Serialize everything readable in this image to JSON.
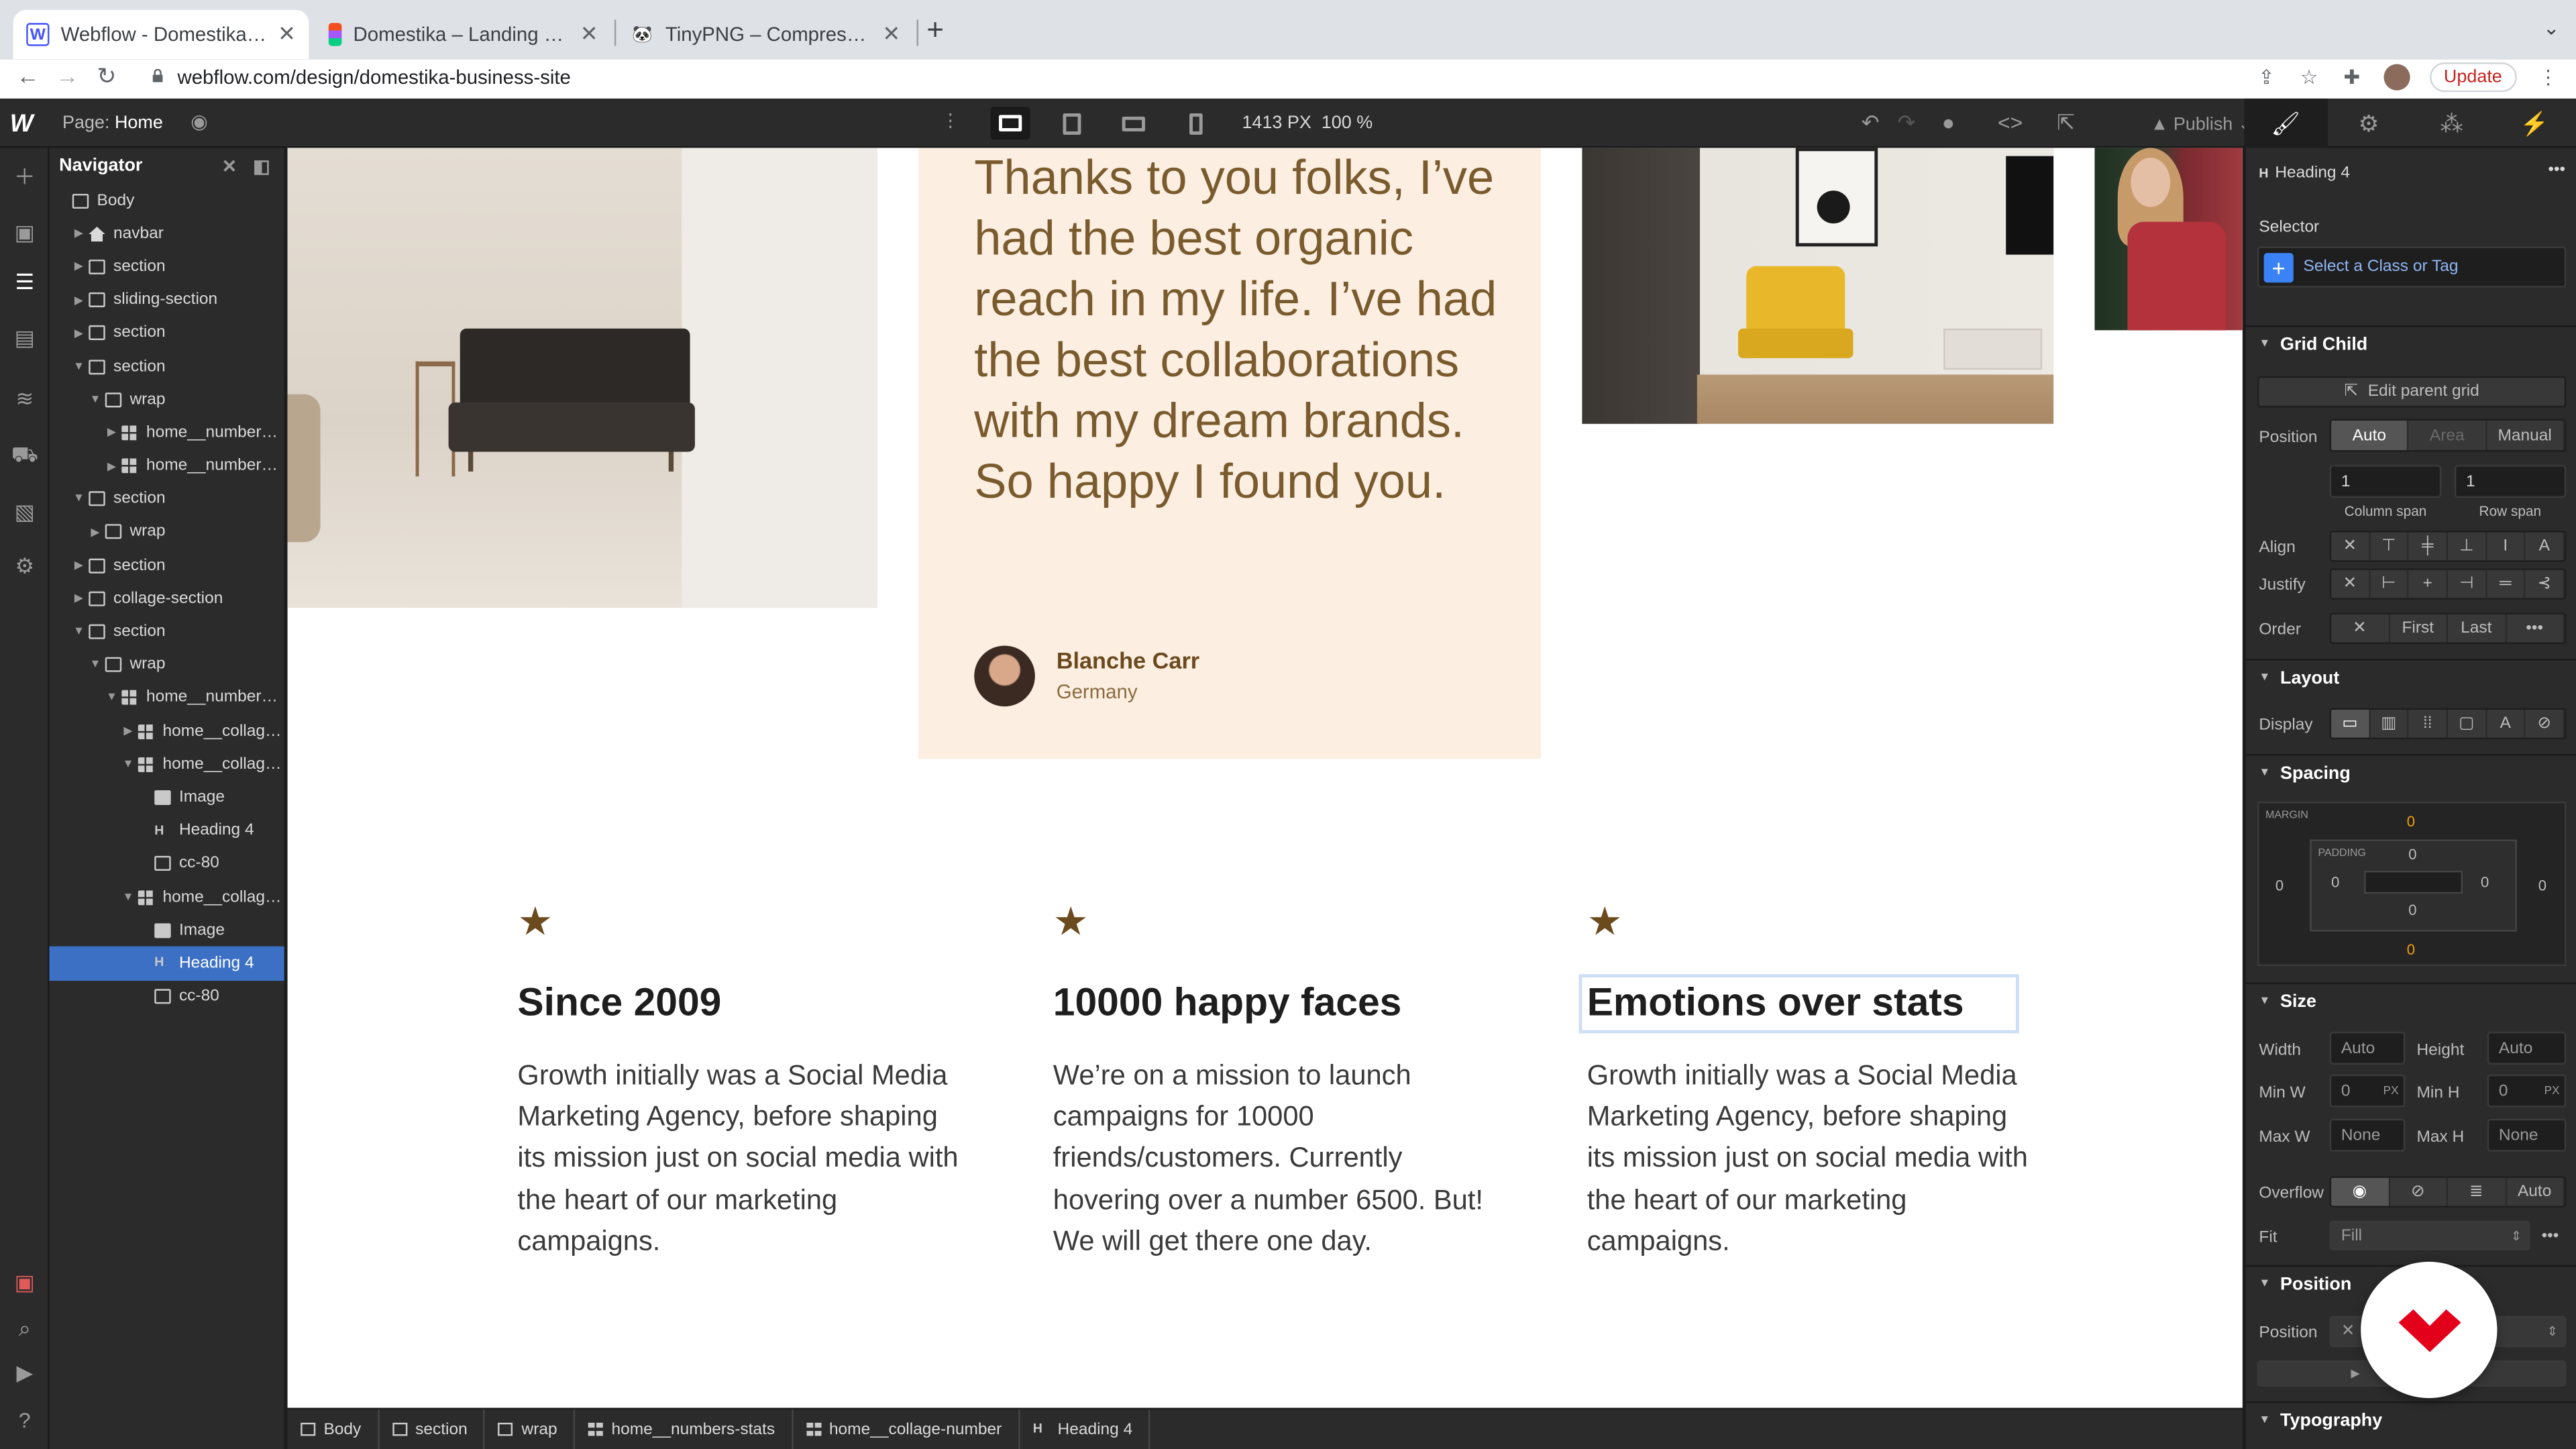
{
  "browser": {
    "tabs": [
      {
        "title": "Webflow - Domestika - Landing Page",
        "active": true
      },
      {
        "title": "Domestika – Landing Page – Figma",
        "active": false
      },
      {
        "title": "TinyPNG – Compress WebP, PNG and JPEG",
        "active": false
      }
    ],
    "url": "webflow.com/design/domestika-business-site",
    "update_label": "Update"
  },
  "designer": {
    "page_label": "Page:",
    "page_name": "Home",
    "canvas_width": "1413 PX",
    "zoom": "100 %",
    "publish_label": "Publish"
  },
  "navigator": {
    "title": "Navigator",
    "items": [
      {
        "label": "Body",
        "depth": 0,
        "caret": "",
        "icon": "box"
      },
      {
        "label": "navbar",
        "depth": 1,
        "caret": "▶",
        "icon": "home"
      },
      {
        "label": "section",
        "depth": 1,
        "caret": "▶",
        "icon": "box"
      },
      {
        "label": "sliding-section",
        "depth": 1,
        "caret": "▶",
        "icon": "box"
      },
      {
        "label": "section",
        "depth": 1,
        "caret": "▶",
        "icon": "box"
      },
      {
        "label": "section",
        "depth": 1,
        "caret": "▼",
        "icon": "box"
      },
      {
        "label": "wrap",
        "depth": 2,
        "caret": "▼",
        "icon": "box"
      },
      {
        "label": "home__numbers-heading",
        "depth": 3,
        "caret": "▶",
        "icon": "grid"
      },
      {
        "label": "home__numbers-stats",
        "depth": 3,
        "caret": "▶",
        "icon": "grid"
      },
      {
        "label": "section",
        "depth": 1,
        "caret": "▼",
        "icon": "box"
      },
      {
        "label": "wrap",
        "depth": 2,
        "caret": "▶",
        "icon": "box"
      },
      {
        "label": "section",
        "depth": 1,
        "caret": "▶",
        "icon": "box"
      },
      {
        "label": "collage-section",
        "depth": 1,
        "caret": "▶",
        "icon": "box"
      },
      {
        "label": "section",
        "depth": 1,
        "caret": "▼",
        "icon": "box"
      },
      {
        "label": "wrap",
        "depth": 2,
        "caret": "▼",
        "icon": "box"
      },
      {
        "label": "home__numbers-stats",
        "depth": 3,
        "caret": "▼",
        "icon": "grid"
      },
      {
        "label": "home__collage-number",
        "depth": 4,
        "caret": "▶",
        "icon": "grid"
      },
      {
        "label": "home__collage-number",
        "depth": 4,
        "caret": "▼",
        "icon": "grid"
      },
      {
        "label": "Image",
        "depth": 5,
        "caret": "",
        "icon": "img"
      },
      {
        "label": "Heading 4",
        "depth": 5,
        "caret": "",
        "icon": "heading"
      },
      {
        "label": "cc-80",
        "depth": 5,
        "caret": "",
        "icon": "text"
      },
      {
        "label": "home__collage-number",
        "depth": 4,
        "caret": "▼",
        "icon": "grid"
      },
      {
        "label": "Image",
        "depth": 5,
        "caret": "",
        "icon": "img"
      },
      {
        "label": "Heading 4",
        "depth": 5,
        "caret": "",
        "icon": "heading",
        "selected": true
      },
      {
        "label": "cc-80",
        "depth": 5,
        "caret": "",
        "icon": "text"
      }
    ]
  },
  "canvas": {
    "quote": "Thanks to you folks, I’ve had the best organic reach in my life. I’ve had the best collaborations with my dream brands. So happy I found you.",
    "author_name": "Blanche Carr",
    "author_location": "Germany",
    "features": [
      {
        "title": "Since 2009",
        "body": "Growth initially was a Social Media Marketing Agency, before shaping its mission just on social media with the heart of our marketing campaigns.",
        "selected": false
      },
      {
        "title": "10000 happy faces",
        "body": "We’re on a mission to launch campaigns for 10000 friends/customers. Currently hovering over a number 6500. But! We will get there one day.",
        "selected": false
      },
      {
        "title": "Emotions over stats",
        "body": "Growth initially was a Social Media Marketing Agency, before shaping its mission just on social media with the heart of our marketing campaigns.",
        "selected": true
      }
    ]
  },
  "breadcrumbs": [
    {
      "label": "Body",
      "icon": "box"
    },
    {
      "label": "section",
      "icon": "box"
    },
    {
      "label": "wrap",
      "icon": "box"
    },
    {
      "label": "home__numbers-stats",
      "icon": "grid"
    },
    {
      "label": "home__collage-number",
      "icon": "grid"
    },
    {
      "label": "Heading 4",
      "icon": "heading"
    }
  ],
  "style_panel": {
    "element": "Heading 4",
    "selector_label": "Selector",
    "selector_placeholder": "Select a Class or Tag",
    "grid_child": {
      "title": "Grid Child",
      "edit_parent": "Edit parent grid",
      "position_label": "Position",
      "position_options": [
        "Auto",
        "Area",
        "Manual"
      ],
      "column_span_value": "1",
      "row_span_value": "1",
      "column_span_label": "Column span",
      "row_span_label": "Row span",
      "align_label": "Align",
      "justify_label": "Justify",
      "order_label": "Order",
      "order_options": [
        "First",
        "Last"
      ]
    },
    "layout": {
      "title": "Layout",
      "display_label": "Display"
    },
    "spacing": {
      "title": "Spacing",
      "margin_label": "MARGIN",
      "padding_label": "PADDING",
      "margin": {
        "top": "0",
        "right": "0",
        "bottom": "0",
        "left": "0"
      },
      "padding": {
        "top": "0",
        "right": "0",
        "bottom": "0",
        "left": "0"
      }
    },
    "size": {
      "title": "Size",
      "width_label": "Width",
      "width_value": "Auto",
      "height_label": "Height",
      "height_value": "Auto",
      "minw_label": "Min W",
      "minw_value": "0",
      "minh_label": "Min H",
      "minh_value": "0",
      "maxw_label": "Max W",
      "maxw_value": "None",
      "maxh_label": "Max H",
      "maxh_value": "None",
      "unit": "PX",
      "overflow_label": "Overflow",
      "overflow_auto": "Auto",
      "fit_label": "Fit",
      "fit_value": "Fill"
    },
    "position": {
      "title": "Position",
      "position_label": "Position"
    },
    "typography": {
      "title": "Typography"
    }
  },
  "colors": {
    "accent": "#3b70c5",
    "quote_text": "#7a5b2e",
    "testimonial_bg": "#fcefe2",
    "star": "#6b4a1e",
    "domestika_red": "#e3001b"
  }
}
